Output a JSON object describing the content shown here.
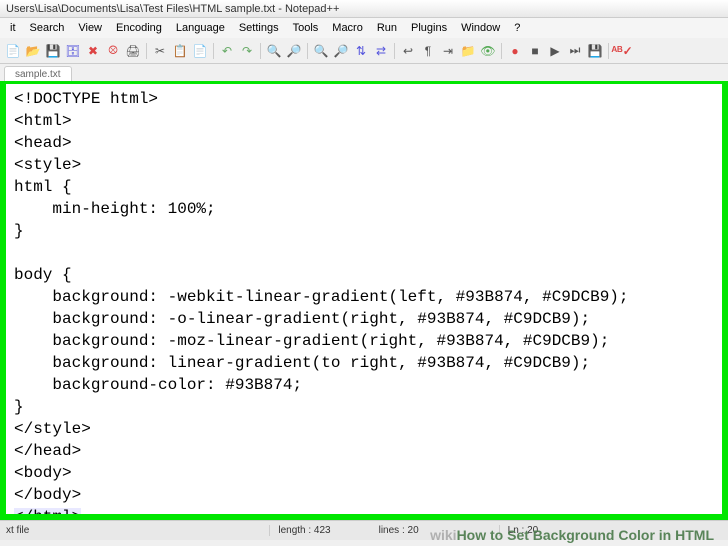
{
  "title": "Users\\Lisa\\Documents\\Lisa\\Test Files\\HTML sample.txt - Notepad++",
  "menu": [
    "it",
    "Search",
    "View",
    "Encoding",
    "Language",
    "Settings",
    "Tools",
    "Macro",
    "Run",
    "Plugins",
    "Window",
    "?"
  ],
  "tab": "sample.txt",
  "code_lines": [
    "<!DOCTYPE html>",
    "<html>",
    "<head>",
    "<style>",
    "html {",
    "    min-height: 100%;",
    "}",
    "",
    "body {",
    "    background: -webkit-linear-gradient(left, #93B874, #C9DCB9);",
    "    background: -o-linear-gradient(right, #93B874, #C9DCB9);",
    "    background: -moz-linear-gradient(right, #93B874, #C9DCB9);",
    "    background: linear-gradient(to right, #93B874, #C9DCB9);",
    "    background-color: #93B874;",
    "}",
    "</style>",
    "</head>",
    "<body>",
    "</body>",
    "</html>"
  ],
  "status": {
    "filetype": "xt file",
    "length": "length : 423",
    "lines": "lines : 20",
    "ln": "Ln : 20"
  },
  "watermark_prefix": "wiki",
  "watermark_text": "How to Set Background Color in HTML"
}
